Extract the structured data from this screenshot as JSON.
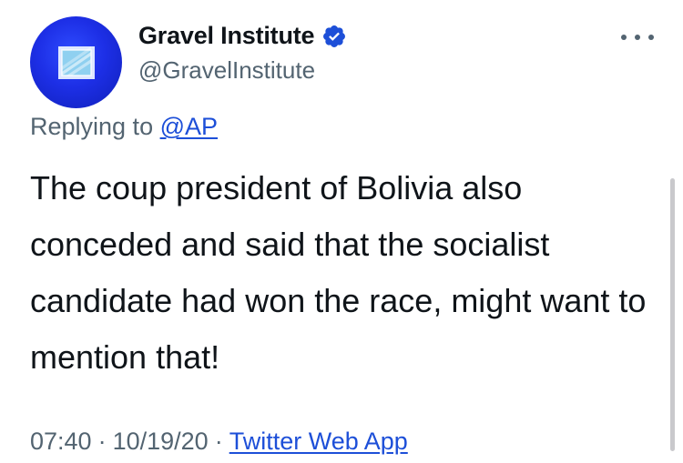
{
  "author": {
    "display_name": "Gravel Institute",
    "handle": "@GravelInstitute",
    "verified": true,
    "avatar_icon": "gravel-institute-logo",
    "avatar_color": "#1d2fe6"
  },
  "reply": {
    "prefix": "Replying to ",
    "target": "@AP"
  },
  "tweet": {
    "text": "The coup president of Bolivia also conceded and said that the socialist candidate had won the race, might want to mention that!"
  },
  "meta": {
    "time": "07:40",
    "date": "10/19/20",
    "separator": "·",
    "source": "Twitter Web App"
  },
  "colors": {
    "link": "#1d4fd8",
    "secondary_text": "#536471",
    "verified_badge": "#1d4fd8"
  }
}
